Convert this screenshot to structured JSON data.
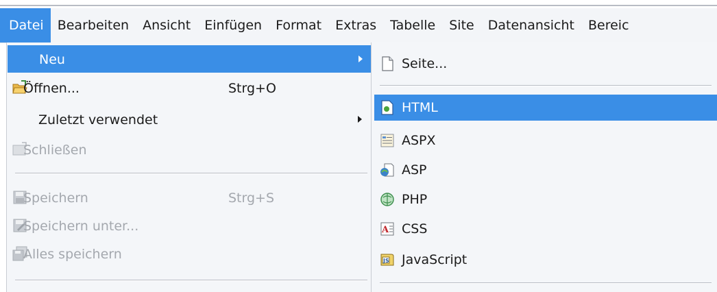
{
  "menubar": {
    "items": [
      "Datei",
      "Bearbeiten",
      "Ansicht",
      "Einfügen",
      "Format",
      "Extras",
      "Tabelle",
      "Site",
      "Datenansicht",
      "Bereic"
    ]
  },
  "file_menu": {
    "items": [
      {
        "label": "Neu",
        "shortcut": "",
        "icon": "none"
      },
      {
        "label": "Öffnen...",
        "shortcut": "Strg+O",
        "icon": "open-folder-icon"
      },
      {
        "label": "Zuletzt verwendet",
        "shortcut": "",
        "icon": "none"
      },
      {
        "label": "Schließen",
        "shortcut": "",
        "icon": "close-document-icon"
      },
      {
        "label": "Speichern",
        "shortcut": "Strg+S",
        "icon": "save-icon"
      },
      {
        "label": "Speichern unter...",
        "shortcut": "",
        "icon": "save-as-icon"
      },
      {
        "label": "Alles speichern",
        "shortcut": "",
        "icon": "save-all-icon"
      }
    ]
  },
  "new_submenu": {
    "items": [
      {
        "label": "Seite...",
        "icon": "page-icon"
      },
      {
        "label": "HTML",
        "icon": "html-file-icon"
      },
      {
        "label": "ASPX",
        "icon": "aspx-file-icon"
      },
      {
        "label": "ASP",
        "icon": "asp-file-icon"
      },
      {
        "label": "PHP",
        "icon": "php-file-icon"
      },
      {
        "label": "CSS",
        "icon": "css-file-icon"
      },
      {
        "label": "JavaScript",
        "icon": "javascript-file-icon"
      }
    ]
  },
  "colors": {
    "highlight": "#3a8ee6",
    "menu_bg": "#f4f6f9",
    "disabled_text": "#a4a8ae"
  }
}
